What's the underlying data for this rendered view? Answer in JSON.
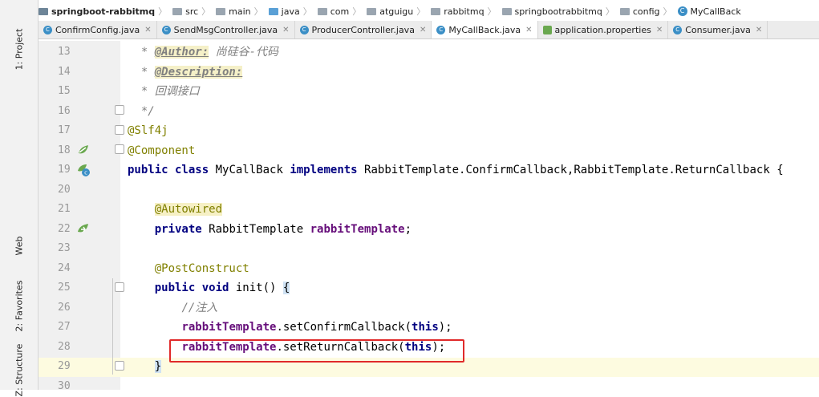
{
  "breadcrumb": [
    "springboot-rabbitmq",
    "src",
    "main",
    "java",
    "com",
    "atguigu",
    "rabbitmq",
    "springbootrabbitmq",
    "config",
    "MyCallBack"
  ],
  "tabs": [
    {
      "label": "ConfirmConfig.java",
      "icon": "class-icon"
    },
    {
      "label": "SendMsgController.java",
      "icon": "class-icon"
    },
    {
      "label": "ProducerController.java",
      "icon": "class-icon"
    },
    {
      "label": "MyCallBack.java",
      "icon": "class-icon",
      "active": true
    },
    {
      "label": "application.properties",
      "icon": "properties-icon"
    },
    {
      "label": "Consumer.java",
      "icon": "class-icon"
    }
  ],
  "tool_windows": [
    "1: Project",
    "Web",
    "2: Favorites",
    "Z: Structure"
  ],
  "lines": [
    {
      "n": "13",
      "text": " * @Author: 尚硅谷-代码"
    },
    {
      "n": "14",
      "text": " * @Description:"
    },
    {
      "n": "15",
      "text": " * 回调接口"
    },
    {
      "n": "16",
      "text": " */"
    },
    {
      "n": "17",
      "text": "@Slf4j"
    },
    {
      "n": "18",
      "text": "@Component"
    },
    {
      "n": "19",
      "text": "public class MyCallBack implements RabbitTemplate.ConfirmCallback,RabbitTemplate.ReturnCallback {"
    },
    {
      "n": "20",
      "text": ""
    },
    {
      "n": "21",
      "text": "    @Autowired"
    },
    {
      "n": "22",
      "text": "    private RabbitTemplate rabbitTemplate;"
    },
    {
      "n": "23",
      "text": ""
    },
    {
      "n": "24",
      "text": "    @PostConstruct"
    },
    {
      "n": "25",
      "text": "    public void init() {"
    },
    {
      "n": "26",
      "text": "        //注入"
    },
    {
      "n": "27",
      "text": "        rabbitTemplate.setConfirmCallback(this);"
    },
    {
      "n": "28",
      "text": "        rabbitTemplate.setReturnCallback(this);"
    },
    {
      "n": "29",
      "text": "    }"
    },
    {
      "n": "30",
      "text": ""
    }
  ],
  "colors": {
    "keyword": "#000080",
    "annotation": "#808000",
    "field": "#660e7a",
    "comment": "#808080",
    "highlight_box": "#e02a2a"
  }
}
